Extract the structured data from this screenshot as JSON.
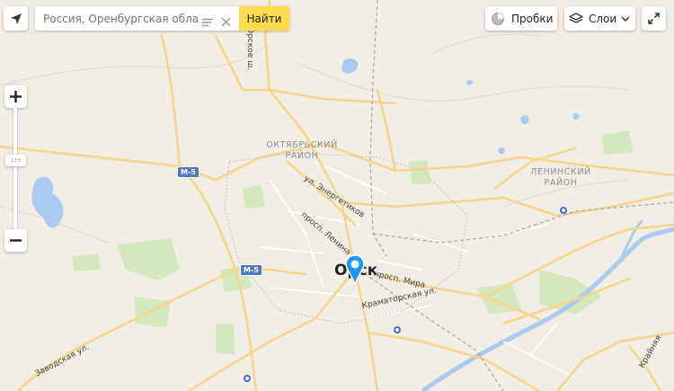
{
  "search": {
    "placeholder": "Россия, Оренбургская область, ",
    "button_label": "Найти"
  },
  "controls": {
    "traffic_label": "Пробки",
    "layers_label": "Слои"
  },
  "map": {
    "city_label": "Орск",
    "district_labels": [
      {
        "line1": "ОКТЯБРЬСКИЙ",
        "line2": "РАЙОН"
      },
      {
        "line1": "ЛЕНИНСКИЙ",
        "line2": "РАЙОН"
      }
    ],
    "streets": {
      "energetikov": "ул. Энергетиков",
      "lenina": "просп. Ленина",
      "mira": "просп. Мира",
      "kramatorskaya": "Краматорская ул.",
      "zavodskaya": "Заводская ул.",
      "krainyaya": "Крайняя",
      "top": "Орское ш."
    },
    "road_badges": [
      "М-5",
      "М-5"
    ]
  },
  "colors": {
    "background": "#f1ede4",
    "road_major": "#f6d58a",
    "water": "#aacbf0",
    "park": "#d3e8bf",
    "accent": "#ffdb4d",
    "pin": "#1e98ff"
  }
}
